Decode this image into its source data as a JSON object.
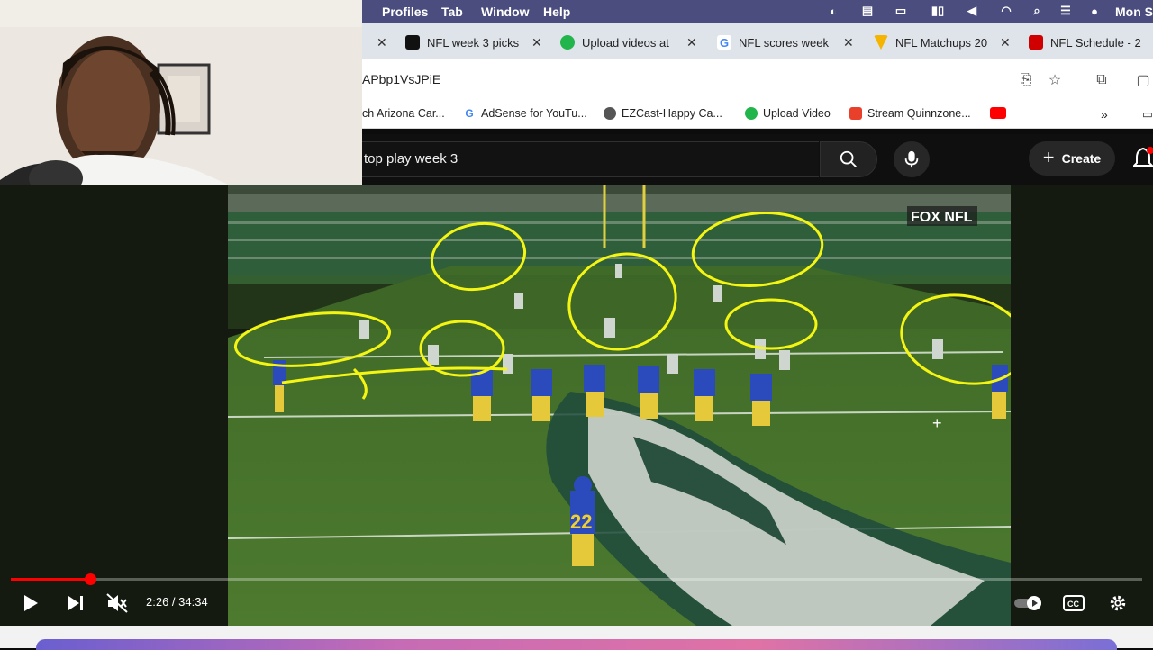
{
  "menubar": {
    "items": [
      "Profiles",
      "Tab",
      "Window",
      "Help"
    ],
    "clock": "Mon S"
  },
  "tabs": [
    {
      "title": "NFL week 3 picks",
      "fav_color": "#111111"
    },
    {
      "title": "Upload videos at",
      "fav_color": "#21b54b"
    },
    {
      "title": "NFL scores week",
      "fav_color": "#4285f4"
    },
    {
      "title": "NFL Matchups 20",
      "fav_color": "#f4b400"
    },
    {
      "title": "NFL Schedule - 2",
      "fav_color": "#d00000"
    }
  ],
  "address": {
    "url": "APbp1VsJPiE"
  },
  "bookmarks": [
    {
      "label": "ch Arizona Car...",
      "fav_color": "#ffffff"
    },
    {
      "label": "AdSense for YouTu...",
      "fav_color": "#4285f4"
    },
    {
      "label": "EZCast-Happy Ca...",
      "fav_color": "#555555"
    },
    {
      "label": "Upload Video",
      "fav_color": "#21b54b"
    },
    {
      "label": "Stream Quinnzone...",
      "fav_color": "#e8402b"
    },
    {
      "label": "",
      "fav_color": "#ff0000"
    }
  ],
  "youtube": {
    "search_query": "top play week 3",
    "create_label": "Create"
  },
  "broadcast": {
    "network_logo": "FOX NFL"
  },
  "player": {
    "current_time": "2:26",
    "duration": "34:34",
    "time_display": "2:26 / 34:34",
    "progress_fraction": 0.0704,
    "muted": true
  },
  "colors": {
    "accent": "#ff0000",
    "annotation": "#f5f514",
    "menubar": "#4a4d7e"
  }
}
